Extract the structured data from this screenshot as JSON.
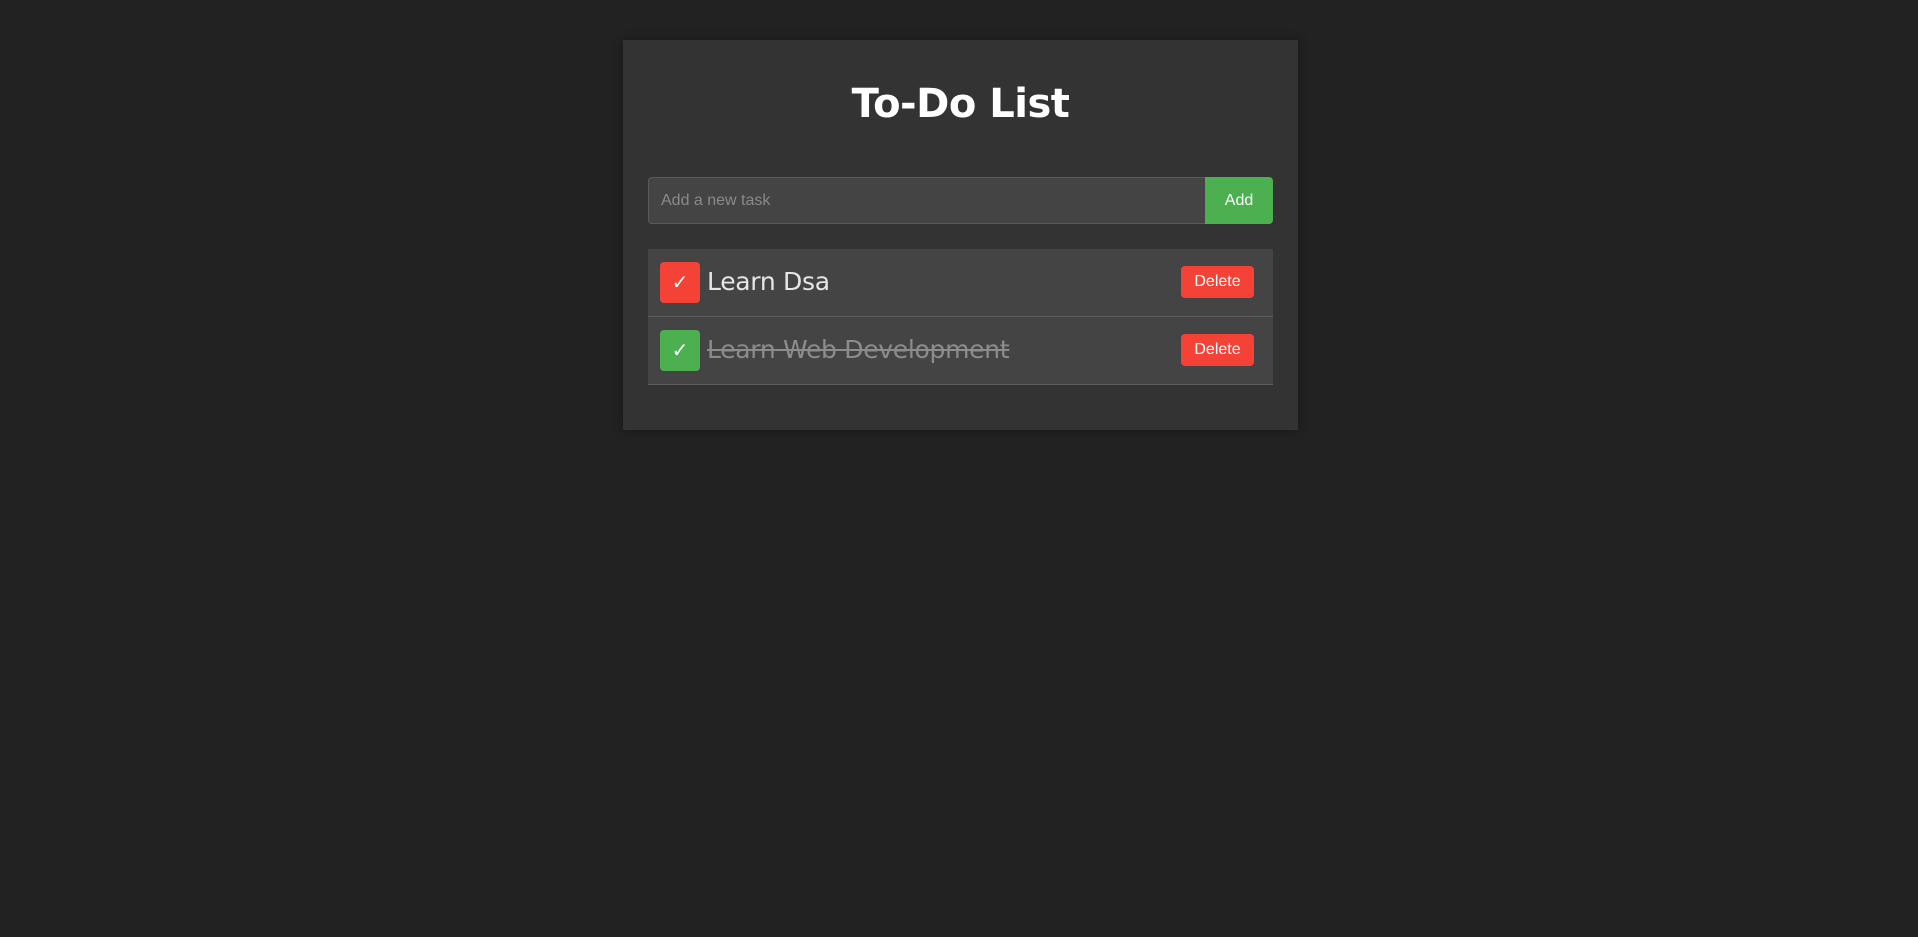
{
  "app": {
    "title": "To-Do List"
  },
  "new_task": {
    "placeholder": "Add a new task",
    "value": "",
    "add_label": "Add"
  },
  "tasks": [
    {
      "text": "Learn Dsa",
      "completed": false,
      "check_glyph": "✓",
      "check_color": "#f44336",
      "delete_label": "Delete"
    },
    {
      "text": "Learn Web Development",
      "completed": true,
      "check_glyph": "✓",
      "check_color": "#4caf50",
      "delete_label": "Delete"
    }
  ],
  "colors": {
    "page_background": "#222222",
    "card_background": "#333333",
    "accent_green": "#4caf50",
    "danger_red": "#f44336"
  }
}
